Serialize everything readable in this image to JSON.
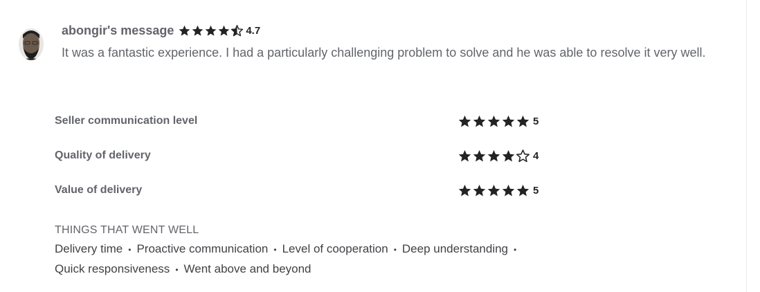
{
  "review": {
    "reviewer_title": "abongir's message",
    "rating": "4.7",
    "rating_value": 4.7,
    "text": "It was a fantastic experience. I had a particularly challenging problem to solve and he was able to resolve it very well."
  },
  "criteria": [
    {
      "label": "Seller communication level",
      "rating": "5",
      "rating_value": 5
    },
    {
      "label": "Quality of delivery",
      "rating": "4",
      "rating_value": 4
    },
    {
      "label": "Value of delivery",
      "rating": "5",
      "rating_value": 5
    }
  ],
  "went_well": {
    "title": "THINGS THAT WENT WELL",
    "tags": [
      "Delivery time",
      "Proactive communication",
      "Level of cooperation",
      "Deep understanding",
      "Quick responsiveness",
      "Went above and beyond"
    ],
    "separator": "•"
  },
  "icons": {
    "avatar": "avatar-photo",
    "star_full": "star-filled-icon",
    "star_half": "star-half-icon",
    "star_empty": "star-outline-icon"
  },
  "colors": {
    "star": "#222325",
    "text_muted": "#62646a",
    "text_dark": "#404145"
  }
}
